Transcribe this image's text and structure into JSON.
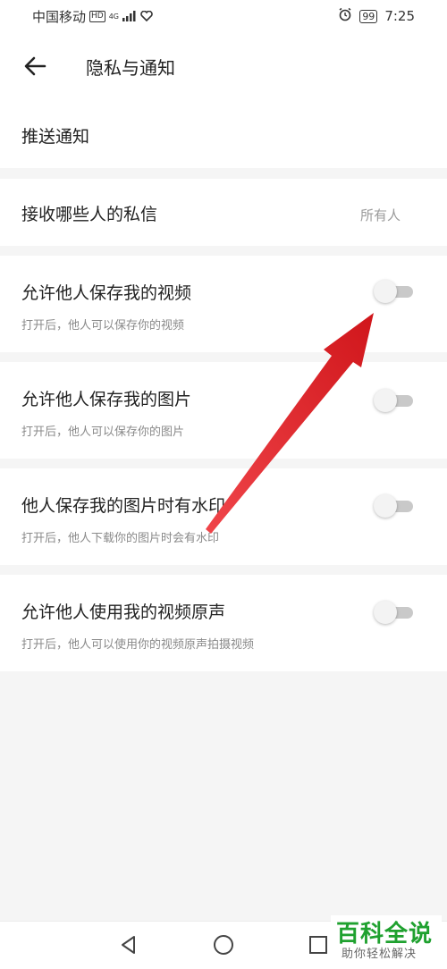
{
  "status_bar": {
    "carrier": "中国移动",
    "hd": "HD",
    "network": "4G",
    "battery": "99",
    "time": "7:25"
  },
  "header": {
    "title": "隐私与通知"
  },
  "settings": {
    "push": {
      "label": "推送通知"
    },
    "dm": {
      "label": "接收哪些人的私信",
      "value": "所有人"
    },
    "items": [
      {
        "label": "允许他人保存我的视频",
        "desc": "打开后，他人可以保存你的视频",
        "enabled": false
      },
      {
        "label": "允许他人保存我的图片",
        "desc": "打开后，他人可以保存你的图片",
        "enabled": false
      },
      {
        "label": "他人保存我的图片时有水印",
        "desc": "打开后，他人下载你的图片时会有水印",
        "enabled": false
      },
      {
        "label": "允许他人使用我的视频原声",
        "desc": "打开后，他人可以使用你的视频原声拍摄视频",
        "enabled": false
      }
    ]
  },
  "watermark": {
    "title": "百科全说",
    "subtitle": "助你轻松解决"
  },
  "colors": {
    "annotation_arrow": "#e5262b",
    "watermark_green": "#1fa12f",
    "toggle_off_track": "#c9c9c9"
  },
  "icons": [
    "back-arrow-icon",
    "alarm-icon",
    "signal-icon",
    "heart-icon",
    "battery-icon",
    "nav-back-icon",
    "nav-home-icon",
    "nav-recent-icon"
  ]
}
